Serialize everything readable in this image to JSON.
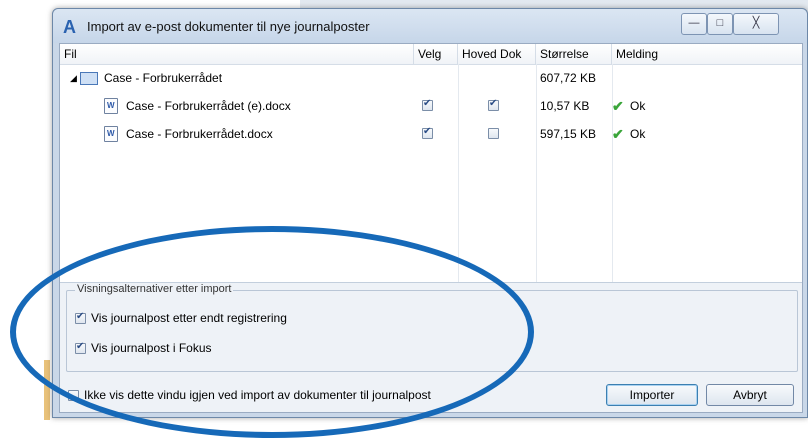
{
  "window": {
    "title": "Import av e-post dokumenter til nye journalposter",
    "controls": {
      "minimize": "—",
      "maximize": "□",
      "close": "╳"
    }
  },
  "table": {
    "columns": [
      "Fil",
      "Velg",
      "Hoved Dok",
      "Størrelse",
      "Melding"
    ],
    "parent": {
      "name": "Case - Forbrukerrådet",
      "size": "607,72 KB"
    },
    "rows": [
      {
        "name": "Case - Forbrukerrådet (e).docx",
        "velg": true,
        "hoved": true,
        "size": "10,57 KB",
        "status": "Ok"
      },
      {
        "name": "Case - Forbrukerrådet.docx",
        "velg": true,
        "hoved": false,
        "size": "597,15 KB",
        "status": "Ok"
      }
    ]
  },
  "options": {
    "group_title": "Visningsalternativer etter import",
    "show_after_registration": {
      "label": "Vis journalpost etter endt registrering",
      "checked": true
    },
    "show_in_focus": {
      "label": "Vis journalpost i Fokus",
      "checked": true
    }
  },
  "footer": {
    "dont_show_again": {
      "label": "Ikke vis dette vindu igjen ved import av dokumenter til journalpost",
      "checked": false
    },
    "import_label": "Importer",
    "cancel_label": "Avbryt"
  },
  "colors": {
    "annotation_circle": "#1669b8",
    "ok_check": "#3aa53a"
  }
}
